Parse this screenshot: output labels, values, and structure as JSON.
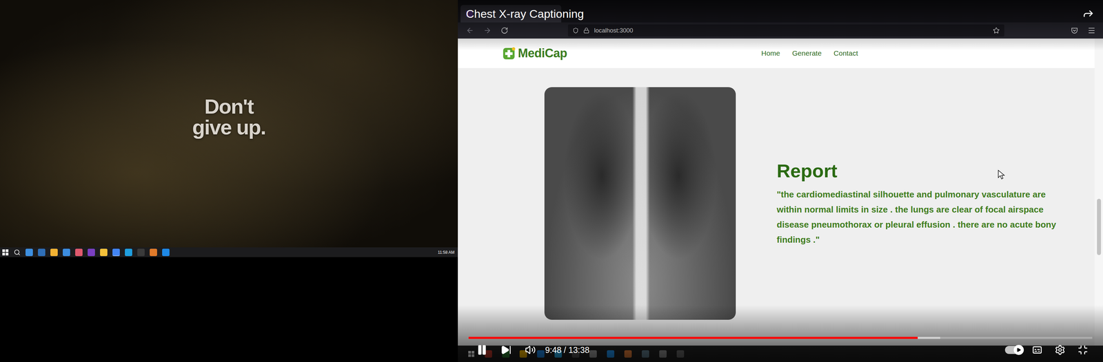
{
  "left_monitor": {
    "wallpaper": {
      "lines": [
        "Don't",
        "give up."
      ]
    },
    "taskbar": {
      "clock": "11:58 AM"
    }
  },
  "browser": {
    "url": "localhost:3000",
    "page": {
      "brand": "MediCap",
      "nav": [
        {
          "label": "Home"
        },
        {
          "label": "Generate"
        },
        {
          "label": "Contact"
        }
      ],
      "report": {
        "heading": "Report",
        "text": "\"the cardiomediastinal silhouette and pulmonary vasculature are within normal limits in size . the lungs are clear of focal airspace disease pneumothorax or pleural effusion . there are no acute bony findings .\""
      }
    }
  },
  "player": {
    "title": "Chest X-ray Captioning",
    "playing": true,
    "progress": {
      "level": 0.72
    },
    "buffer": {
      "level": 0.756
    },
    "time": "9:48 / 13:38",
    "autoplay": {
      "on": true
    }
  }
}
